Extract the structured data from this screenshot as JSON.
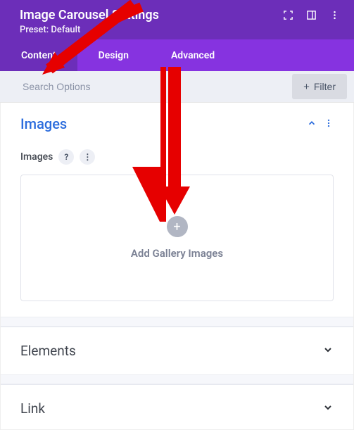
{
  "header": {
    "title": "Image Carousel Settings",
    "preset": "Preset: Default"
  },
  "tabs": {
    "content": "Content",
    "design": "Design",
    "advanced": "Advanced"
  },
  "search": {
    "placeholder": "Search Options",
    "filter_label": "Filter"
  },
  "images_section": {
    "title": "Images",
    "field_label": "Images",
    "dropzone_label": "Add Gallery Images"
  },
  "accordions": {
    "elements": "Elements",
    "link": "Link"
  }
}
